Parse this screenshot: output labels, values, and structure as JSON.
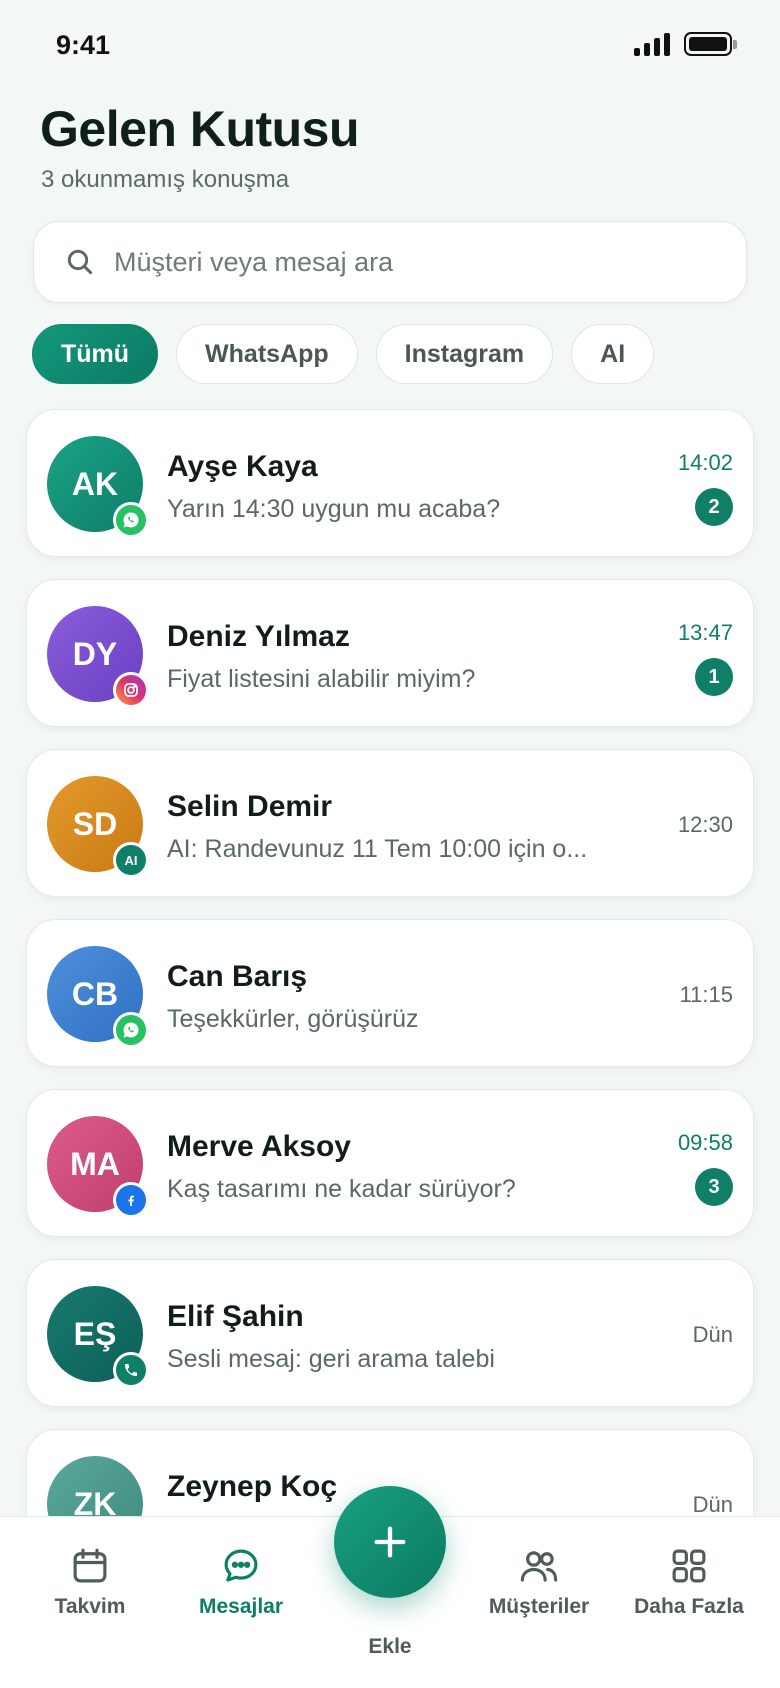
{
  "status": {
    "time": "9:41"
  },
  "header": {
    "title": "Gelen Kutusu",
    "subtitle": "3 okunmamış konuşma"
  },
  "search": {
    "placeholder": "Müşteri veya mesaj ara"
  },
  "filters": [
    {
      "label": "Tümü",
      "active": true
    },
    {
      "label": "WhatsApp",
      "active": false
    },
    {
      "label": "Instagram",
      "active": false
    },
    {
      "label": "AI",
      "active": false
    }
  ],
  "conversations": [
    {
      "initials": "AK",
      "name": "Ayşe Kaya",
      "preview": "Yarın 14:30 uygun mu acaba?",
      "time": "14:02",
      "unread": "2",
      "channel": "whatsapp-icon",
      "color": "#14927a"
    },
    {
      "initials": "DY",
      "name": "Deniz Yılmaz",
      "preview": "Fiyat listesini alabilir miyim?",
      "time": "13:47",
      "unread": "1",
      "channel": "instagram-icon",
      "color": "#7a4fd0"
    },
    {
      "initials": "SD",
      "name": "Selin Demir",
      "preview": "AI: Randevunuz 11 Tem 10:00 için o...",
      "time": "12:30",
      "unread": "",
      "channel": "ai-icon",
      "color": "#d8891f"
    },
    {
      "initials": "CB",
      "name": "Can Barış",
      "preview": "Teşekkürler, görüşürüz",
      "time": "11:15",
      "unread": "",
      "channel": "whatsapp-icon",
      "color": "#3d7fcf"
    },
    {
      "initials": "MA",
      "name": "Merve Aksoy",
      "preview": "Kaş tasarımı ne kadar sürüyor?",
      "time": "09:58",
      "unread": "3",
      "channel": "facebook-icon",
      "color": "#cf4b7f"
    },
    {
      "initials": "EŞ",
      "name": "Elif Şahin",
      "preview": "Sesli mesaj: geri arama talebi",
      "time": "Dün",
      "unread": "",
      "channel": "phone-icon",
      "color": "#136f66"
    },
    {
      "initials": "ZK",
      "name": "Zeynep Koç",
      "preview": "",
      "time": "Dün",
      "unread": "",
      "channel": "",
      "color": "#4a9a8e"
    }
  ],
  "nav": {
    "calendar": "Takvim",
    "messages": "Mesajlar",
    "add": "Ekle",
    "customers": "Müşteriler",
    "more": "Daha Fazla"
  },
  "colors": {
    "accent": "#0d8a6f",
    "background": "#f3f7f6"
  }
}
